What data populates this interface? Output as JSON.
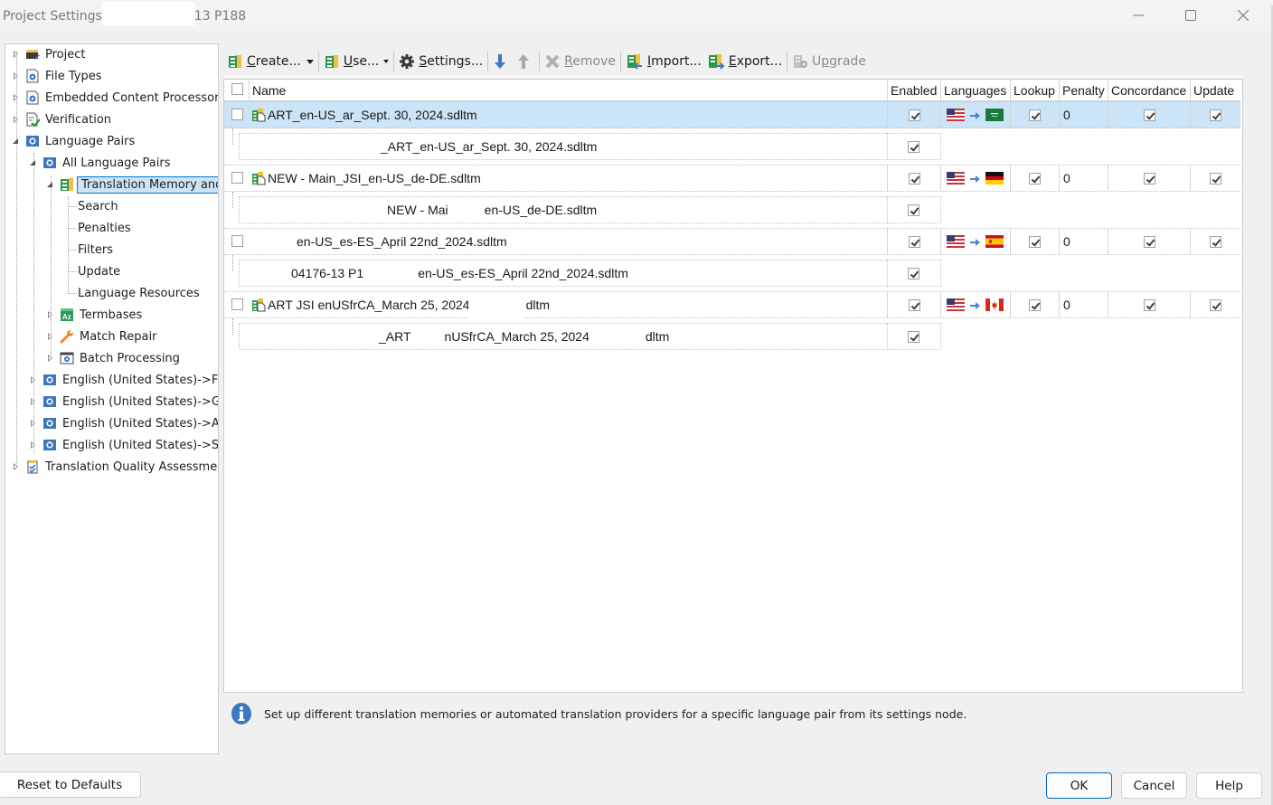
{
  "window": {
    "title": "Project Settings",
    "title_suffix": "13 P188",
    "controls": {
      "minimize": "minimize",
      "maximize": "maximize",
      "close": "close"
    }
  },
  "tree": {
    "items": [
      {
        "label": "Project",
        "icon": "project-icon",
        "expander": "closed",
        "level": 0
      },
      {
        "label": "File Types",
        "icon": "file-settings-icon",
        "expander": "closed",
        "level": 0
      },
      {
        "label": "Embedded Content Processor",
        "icon": "file-settings-icon",
        "expander": "closed",
        "level": 0
      },
      {
        "label": "Verification",
        "icon": "verification-icon",
        "expander": "closed",
        "level": 0
      },
      {
        "label": "Language Pairs",
        "icon": "language-pair-icon",
        "expander": "open",
        "level": 0
      },
      {
        "label": "All Language Pairs",
        "icon": "language-pair-icon",
        "expander": "open",
        "level": 1
      },
      {
        "label": "Translation Memory and",
        "icon": "translation-memory-icon",
        "expander": "open",
        "level": 2,
        "selected": true
      },
      {
        "label": "Search",
        "level": 3
      },
      {
        "label": "Penalties",
        "level": 3
      },
      {
        "label": "Filters",
        "level": 3
      },
      {
        "label": "Update",
        "level": 3
      },
      {
        "label": "Language Resources",
        "level": 3
      },
      {
        "label": "Termbases",
        "icon": "termbase-icon",
        "expander": "closed",
        "level": 2
      },
      {
        "label": "Match Repair",
        "icon": "wrench-icon",
        "expander": "closed",
        "level": 2
      },
      {
        "label": "Batch Processing",
        "icon": "batch-processing-icon",
        "expander": "closed",
        "level": 2
      },
      {
        "label": "English (United States)->Fr",
        "icon": "language-pair-icon",
        "expander": "closed",
        "level": 1
      },
      {
        "label": "English (United States)->Ge",
        "icon": "language-pair-icon",
        "expander": "closed",
        "level": 1
      },
      {
        "label": "English (United States)->Ar",
        "icon": "language-pair-icon",
        "expander": "closed",
        "level": 1
      },
      {
        "label": "English (United States)->Sp",
        "icon": "language-pair-icon",
        "expander": "closed",
        "level": 1
      },
      {
        "label": "Translation Quality Assessmen",
        "icon": "tqa-icon",
        "expander": "closed",
        "level": 0
      }
    ]
  },
  "toolbar": {
    "create": {
      "label": "Create...",
      "mnemonic": "C"
    },
    "use": {
      "label": "Use...",
      "mnemonic": "U"
    },
    "settings": {
      "label": "Settings...",
      "mnemonic": "S"
    },
    "move_down": "move-down",
    "move_up": "move-up",
    "remove": {
      "label": "Remove",
      "mnemonic": "R",
      "disabled": true
    },
    "import": {
      "label": "Import...",
      "mnemonic": "I"
    },
    "export": {
      "label": "Export...",
      "mnemonic": "E"
    },
    "upgrade": {
      "label": "Upgrade",
      "mnemonic": "p",
      "disabled": true
    }
  },
  "grid": {
    "columns": [
      "Name",
      "Enabled",
      "Languages",
      "Lookup",
      "Penalty",
      "Concordance",
      "Update"
    ],
    "rows": [
      {
        "name": "ART_en-US_ar_Sept. 30, 2024.sdltm",
        "child_name": "_ART_en-US_ar_Sept. 30, 2024.sdltm",
        "selected": true,
        "enabled": true,
        "child_enabled": true,
        "source_flag": "US",
        "target_flag": "SA",
        "lookup": true,
        "penalty": "0",
        "concordance": true,
        "update": true
      },
      {
        "name": "NEW - Main_JSI_en-US_de-DE.sdltm",
        "child_name_a": "NEW - Mai",
        "child_name_b": "en-US_de-DE.sdltm",
        "enabled": true,
        "child_enabled": true,
        "source_flag": "US",
        "target_flag": "DE",
        "lookup": true,
        "penalty": "0",
        "concordance": true,
        "update": true
      },
      {
        "name": "en-US_es-ES_April 22nd_2024.sdltm",
        "child_name_a": "04176-13 P1",
        "child_name_b": "en-US_es-ES_April 22nd_2024.sdltm",
        "enabled": true,
        "child_enabled": true,
        "source_flag": "US",
        "target_flag": "ES",
        "lookup": true,
        "penalty": "0",
        "concordance": true,
        "update": true
      },
      {
        "name": "ART JSI enUSfrCA_March 25, 2024",
        "name_tail": "dltm",
        "child_name_a": "_ART",
        "child_name_b": "nUSfrCA_March 25, 2024",
        "child_name_c": "dltm",
        "enabled": true,
        "child_enabled": true,
        "source_flag": "US",
        "target_flag": "CA",
        "lookup": true,
        "penalty": "0",
        "concordance": true,
        "update": true
      }
    ]
  },
  "info": {
    "icon": "info-icon",
    "text": "Set up different translation memories or automated translation providers for a specific language pair from its settings node."
  },
  "buttons": {
    "reset": "Reset to Defaults",
    "ok": "OK",
    "cancel": "Cancel",
    "help": "Help"
  },
  "colors": {
    "selection": "#cce4f7",
    "selection_border": "#0078d7",
    "primary_button_border": "#0067c0",
    "info_icon": "#3c78c0",
    "arrow": "#4a86c8"
  }
}
